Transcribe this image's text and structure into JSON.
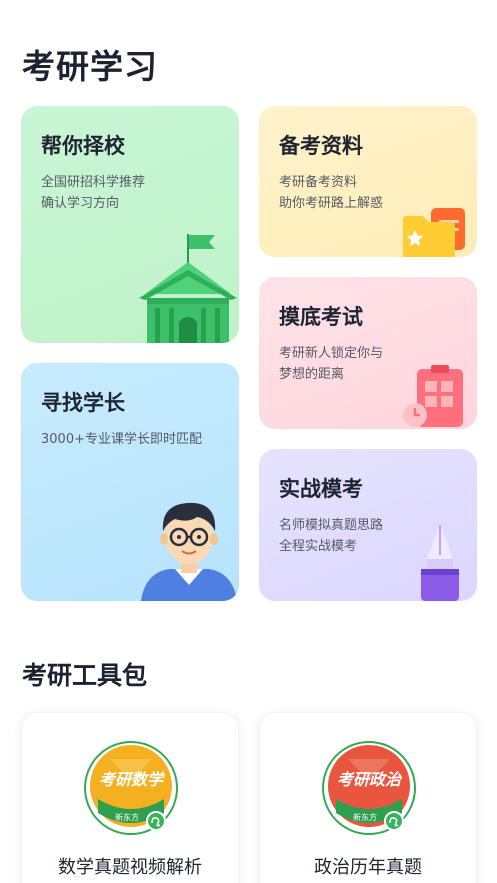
{
  "page": {
    "title": "考研学习"
  },
  "cards": {
    "choose_school": {
      "title": "帮你择校",
      "desc_line1": "全国研招科学推荐",
      "desc_line2": "确认学习方向"
    },
    "materials": {
      "title": "备考资料",
      "desc_line1": "考研备考资料",
      "desc_line2": "助你考研路上解惑"
    },
    "mock_test": {
      "title": "摸底考试",
      "desc_line1": "考研新人锁定你与",
      "desc_line2": "梦想的距离"
    },
    "find_senior": {
      "title": "寻找学长",
      "desc_line1": "3000+专业课学长即时匹配"
    },
    "practice_exam": {
      "title": "实战模考",
      "desc_line1": "名师模拟真题思路",
      "desc_line2": "全程实战模考"
    }
  },
  "toolkit": {
    "title": "考研工具包",
    "items": [
      {
        "badge_text": "考研数学",
        "brand": "新东方",
        "label": "数学真题视频解析",
        "color": "#f5b021"
      },
      {
        "badge_text": "考研政治",
        "brand": "新东方",
        "label": "政治历年真题",
        "color": "#e8563f"
      }
    ]
  }
}
